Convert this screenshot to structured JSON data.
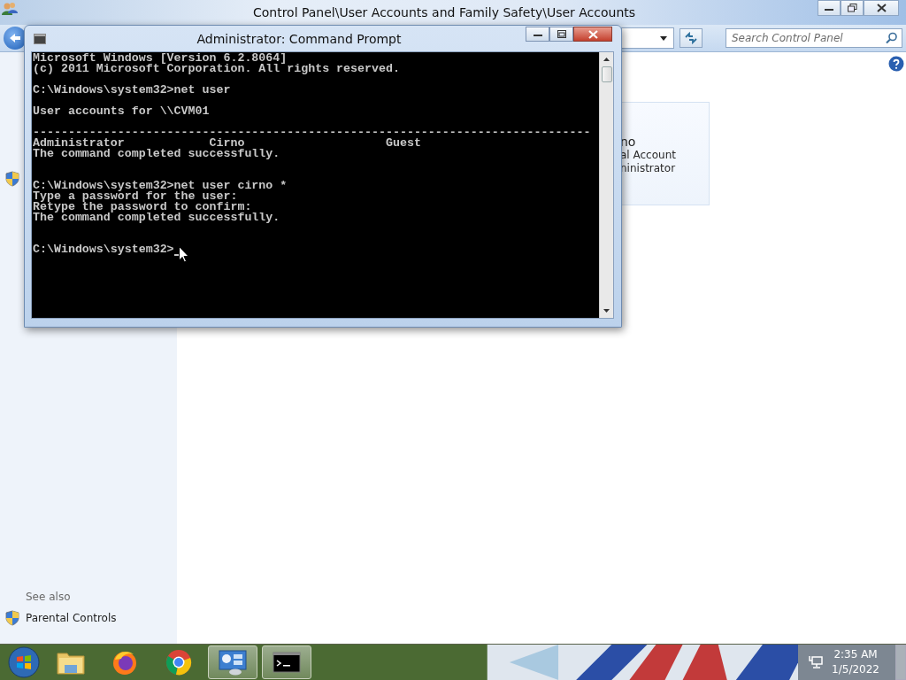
{
  "explorer": {
    "title": "Control Panel\\User Accounts and Family Safety\\User Accounts",
    "search": {
      "placeholder": "Search Control Panel"
    },
    "account_card": {
      "lines": [
        {
          "kind": "name",
          "text": "no"
        },
        {
          "kind": "detail",
          "text": "al Account"
        },
        {
          "kind": "detail",
          "text": "ninistrator"
        }
      ]
    },
    "see_also": {
      "heading": "See also",
      "links": [
        "Parental Controls"
      ]
    }
  },
  "console_window": {
    "title": "Administrator: Command Prompt",
    "blocks": [
      {
        "double_gap": false,
        "cursor": false,
        "lines": [
          "Microsoft Windows [Version 6.2.8064]",
          "(c) 2011 Microsoft Corporation. All rights reserved."
        ]
      },
      {
        "double_gap": false,
        "cursor": false,
        "lines": [
          "C:\\Windows\\system32>net user"
        ]
      },
      {
        "double_gap": false,
        "cursor": false,
        "lines": [
          "User accounts for \\\\CVM01"
        ]
      },
      {
        "double_gap": true,
        "cursor": false,
        "lines": [
          "-------------------------------------------------------------------------------",
          "Administrator            Cirno                    Guest",
          "The command completed successfully."
        ]
      },
      {
        "double_gap": true,
        "cursor": false,
        "lines": [
          "C:\\Windows\\system32>net user cirno *",
          "Type a password for the user:",
          "Retype the password to confirm:",
          "The command completed successfully."
        ]
      },
      {
        "cursor": true,
        "lines": [
          "C:\\Windows\\system32>"
        ]
      }
    ]
  },
  "taskbar": {
    "apps": [
      {
        "kind": "explorer",
        "running": false
      },
      {
        "kind": "firefox",
        "running": false
      },
      {
        "kind": "chrome",
        "running": false
      },
      {
        "kind": "control-panel",
        "running": true
      },
      {
        "kind": "cmd",
        "running": true
      }
    ],
    "clock": {
      "time": "2:35 AM",
      "date": "1/5/2022"
    }
  }
}
